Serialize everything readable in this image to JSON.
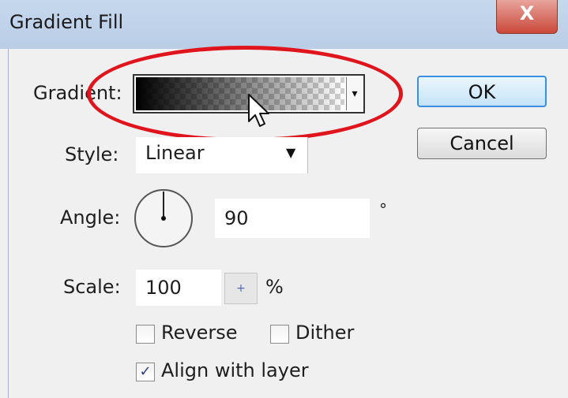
{
  "window": {
    "title": "Gradient Fill",
    "close_glyph": "X"
  },
  "form": {
    "gradient_label": "Gradient:",
    "gradient_dropdown_glyph": "▾",
    "style_label": "Style:",
    "style_value": "Linear",
    "style_dropdown_glyph": "▼",
    "angle_label": "Angle:",
    "angle_value": "90",
    "angle_unit": "°",
    "scale_label": "Scale:",
    "scale_value": "100",
    "scale_stepper_glyph": "+",
    "scale_unit": "%"
  },
  "options": {
    "reverse": {
      "label": "Reverse",
      "checked": false
    },
    "dither": {
      "label": "Dither",
      "checked": false
    },
    "align_with_layer": {
      "label": "Align with layer",
      "checked": true,
      "mark": "✓"
    }
  },
  "buttons": {
    "ok": "OK",
    "cancel": "Cancel"
  },
  "colors": {
    "highlight_ellipse": "#e0141c",
    "ok_border": "#3c8ee0",
    "close_button": "#c9483a"
  },
  "icons": {
    "cursor": "arrow-cursor-icon",
    "angle_dial": "angle-dial-icon"
  }
}
